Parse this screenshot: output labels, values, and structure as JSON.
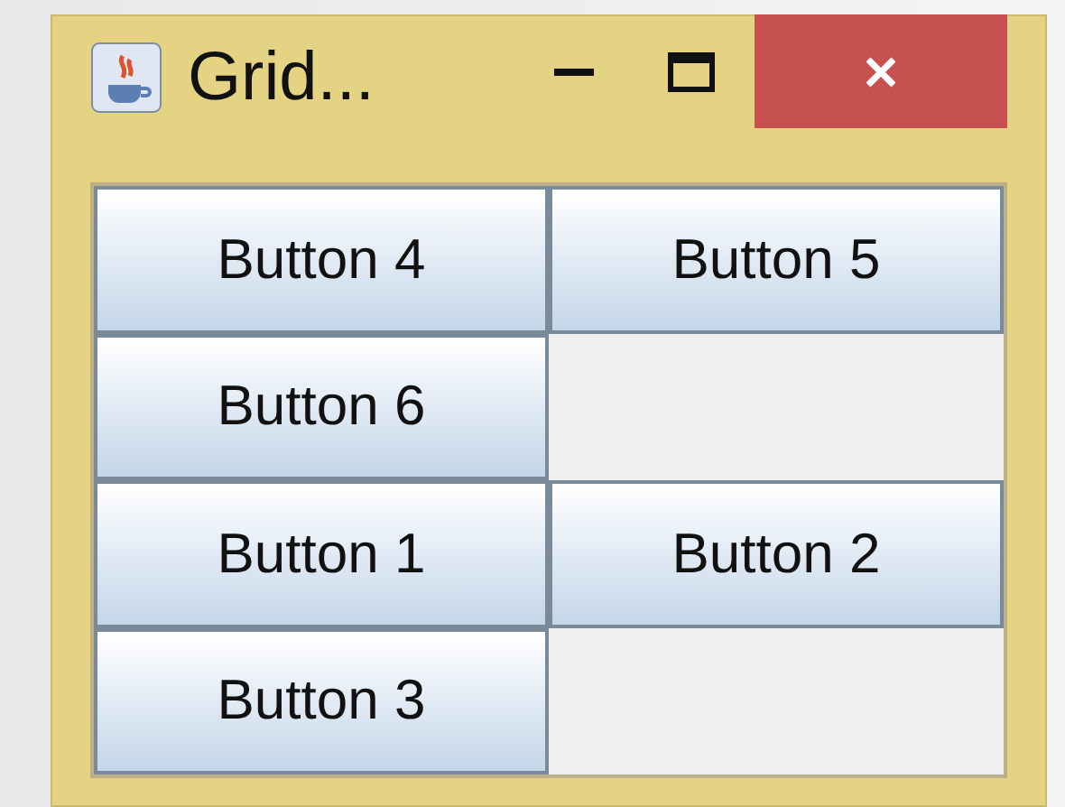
{
  "window": {
    "title": "Grid..."
  },
  "panels": [
    {
      "buttons": [
        {
          "label": "Button 4"
        },
        {
          "label": "Button 5"
        },
        {
          "label": "Button 6"
        }
      ]
    },
    {
      "buttons": [
        {
          "label": "Button 1"
        },
        {
          "label": "Button 2"
        },
        {
          "label": "Button 3"
        }
      ]
    }
  ]
}
